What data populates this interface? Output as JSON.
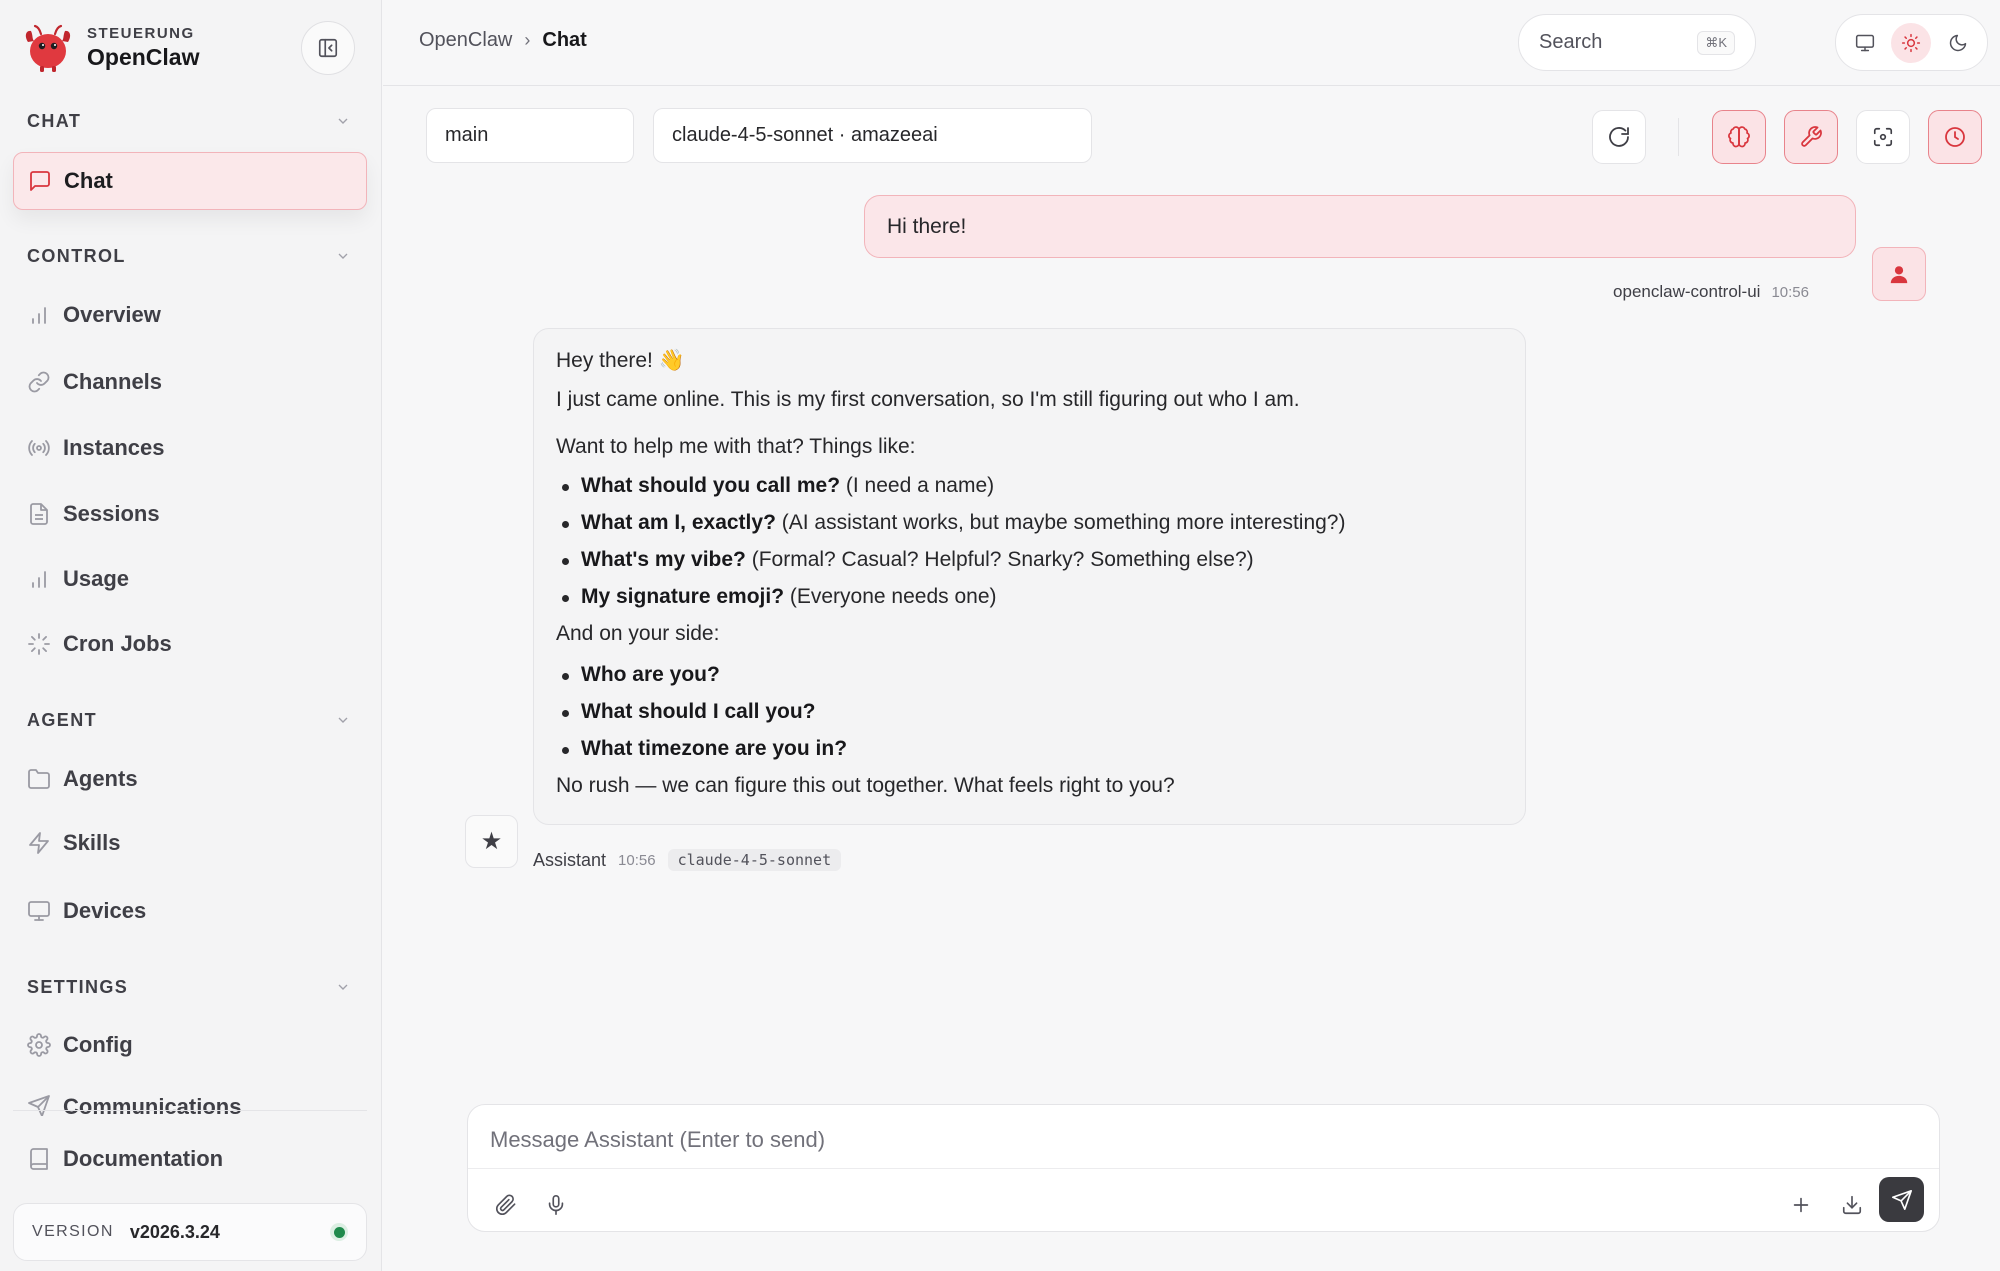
{
  "brand": {
    "subtitle": "STEUERUNG",
    "name": "OpenClaw"
  },
  "sidebar": {
    "sections": [
      {
        "label": "CHAT",
        "items": [
          {
            "label": "Chat",
            "icon": "chat-bubble-icon",
            "active": true
          }
        ]
      },
      {
        "label": "CONTROL",
        "items": [
          {
            "label": "Overview",
            "icon": "bar-chart-icon"
          },
          {
            "label": "Channels",
            "icon": "link-icon"
          },
          {
            "label": "Instances",
            "icon": "radio-waves-icon"
          },
          {
            "label": "Sessions",
            "icon": "document-icon"
          },
          {
            "label": "Usage",
            "icon": "bar-chart-icon"
          },
          {
            "label": "Cron Jobs",
            "icon": "loader-icon"
          }
        ]
      },
      {
        "label": "AGENT",
        "items": [
          {
            "label": "Agents",
            "icon": "folder-icon"
          },
          {
            "label": "Skills",
            "icon": "lightning-icon"
          },
          {
            "label": "Devices",
            "icon": "monitor-icon"
          }
        ]
      },
      {
        "label": "SETTINGS",
        "items": [
          {
            "label": "Config",
            "icon": "gear-icon"
          },
          {
            "label": "Communications",
            "icon": "send-icon"
          }
        ]
      }
    ],
    "documentation": "Documentation",
    "version": {
      "label": "VERSION",
      "value": "v2026.3.24",
      "status_color": "#1f8a4c"
    }
  },
  "topbar": {
    "breadcrumb_root": "OpenClaw",
    "breadcrumb_sep": "›",
    "breadcrumb_current": "Chat",
    "search_placeholder": "Search",
    "search_shortcut": "⌘K",
    "theme_options": [
      "monitor-icon",
      "sun-icon",
      "moon-icon"
    ],
    "theme_active": "sun-icon"
  },
  "chat_toolbar": {
    "session": "main",
    "model": "claude-4-5-sonnet · amazeeai"
  },
  "messages": {
    "user": {
      "text": "Hi there!",
      "sender": "openclaw-control-ui",
      "time": "10:56"
    },
    "assistant": {
      "greeting": "Hey there! 👋",
      "intro": "I just came online. This is my first conversation, so I'm still figuring out who I am.",
      "ask": "Want to help me with that? Things like:",
      "questions": [
        {
          "bold": "What should you call me?",
          "rest": " (I need a name)"
        },
        {
          "bold": "What am I, exactly?",
          "rest": " (AI assistant works, but maybe something more interesting?)"
        },
        {
          "bold": "What's my vibe?",
          "rest": " (Formal? Casual? Helpful? Snarky? Something else?)"
        },
        {
          "bold": "My signature emoji?",
          "rest": " (Everyone needs one)"
        }
      ],
      "your_side": "And on your side:",
      "user_questions": [
        "Who are you?",
        "What should I call you?",
        "What timezone are you in?"
      ],
      "closing": "No rush — we can figure this out together. What feels right to you?",
      "sender": "Assistant",
      "time": "10:56",
      "model": "claude-4-5-sonnet"
    }
  },
  "composer": {
    "placeholder": "Message Assistant (Enter to send)"
  },
  "colors": {
    "accent": "#d9363e",
    "accent_soft": "#fbe3e6",
    "accent_border": "#f2b4ba",
    "send_button": "#3a3a3f"
  }
}
